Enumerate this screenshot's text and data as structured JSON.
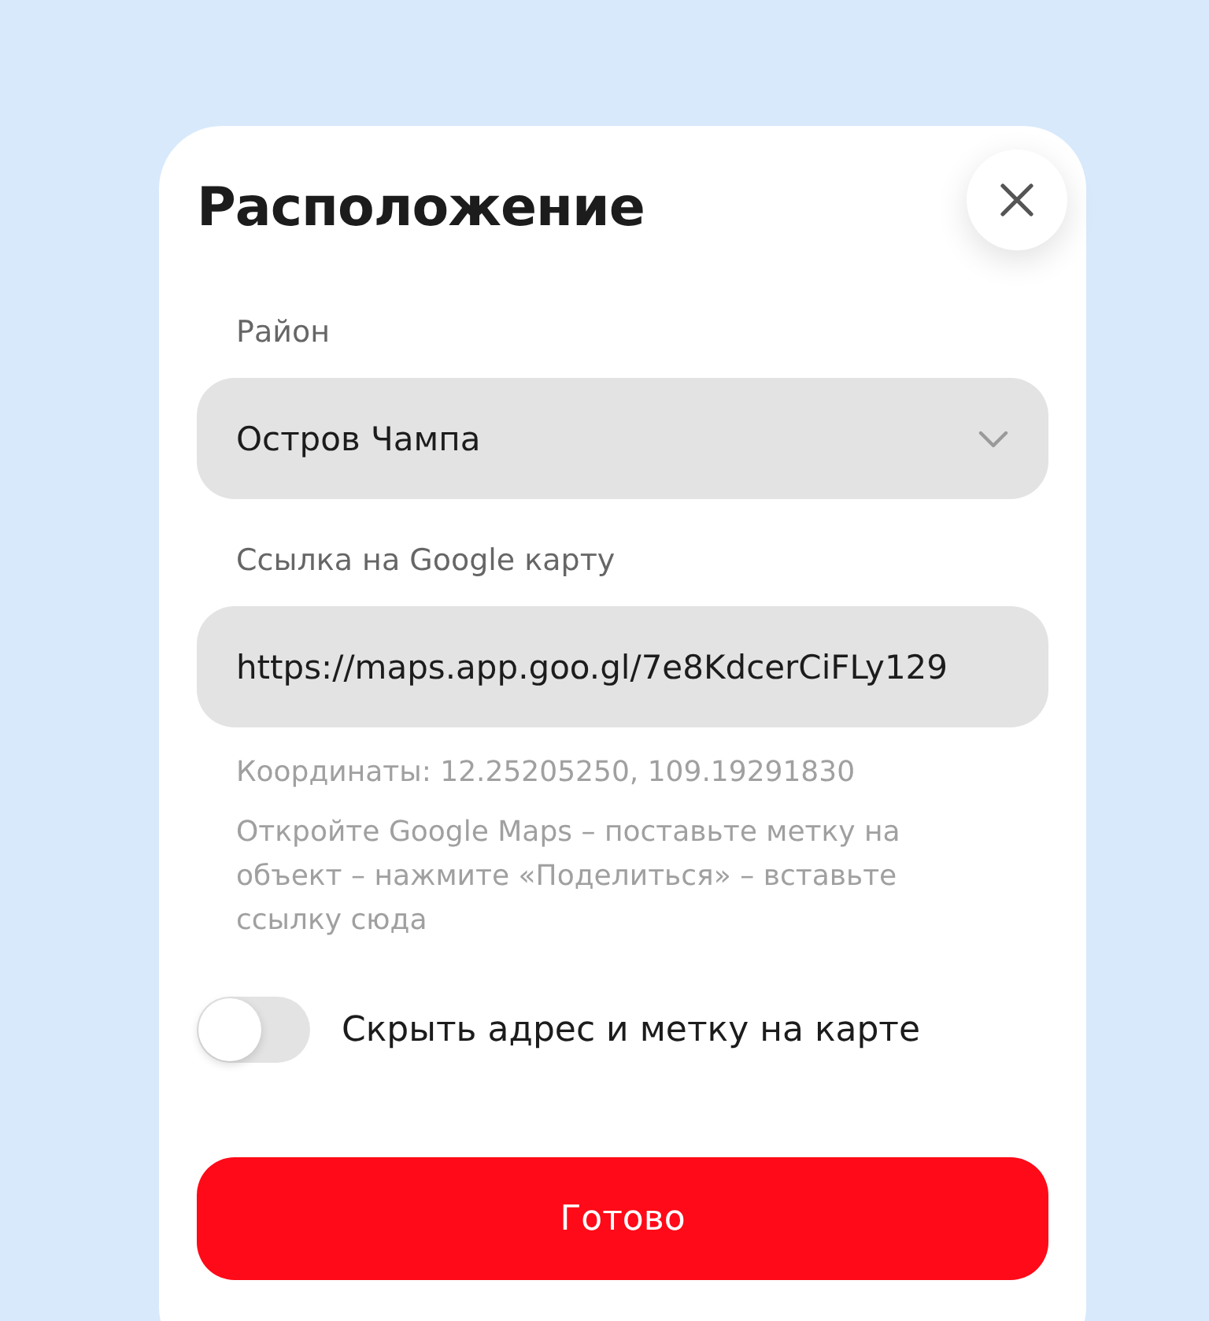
{
  "dialog": {
    "title": "Расположение"
  },
  "district": {
    "label": "Район",
    "value": "Остров Чампа"
  },
  "map_link": {
    "label": "Ссылка на Google карту",
    "value": "https://maps.app.goo.gl/7e8KdcerCiFLy129"
  },
  "coordinates": "Координаты: 12.25205250, 109.19291830",
  "help": "Откройте Google Maps – поставьте метку на объект – нажмите «Поделиться» – вставьте ссылку сюда",
  "hide_toggle": {
    "label": "Скрыть адрес и метку на карте",
    "on": false
  },
  "buttons": [
    "Готово"
  ]
}
